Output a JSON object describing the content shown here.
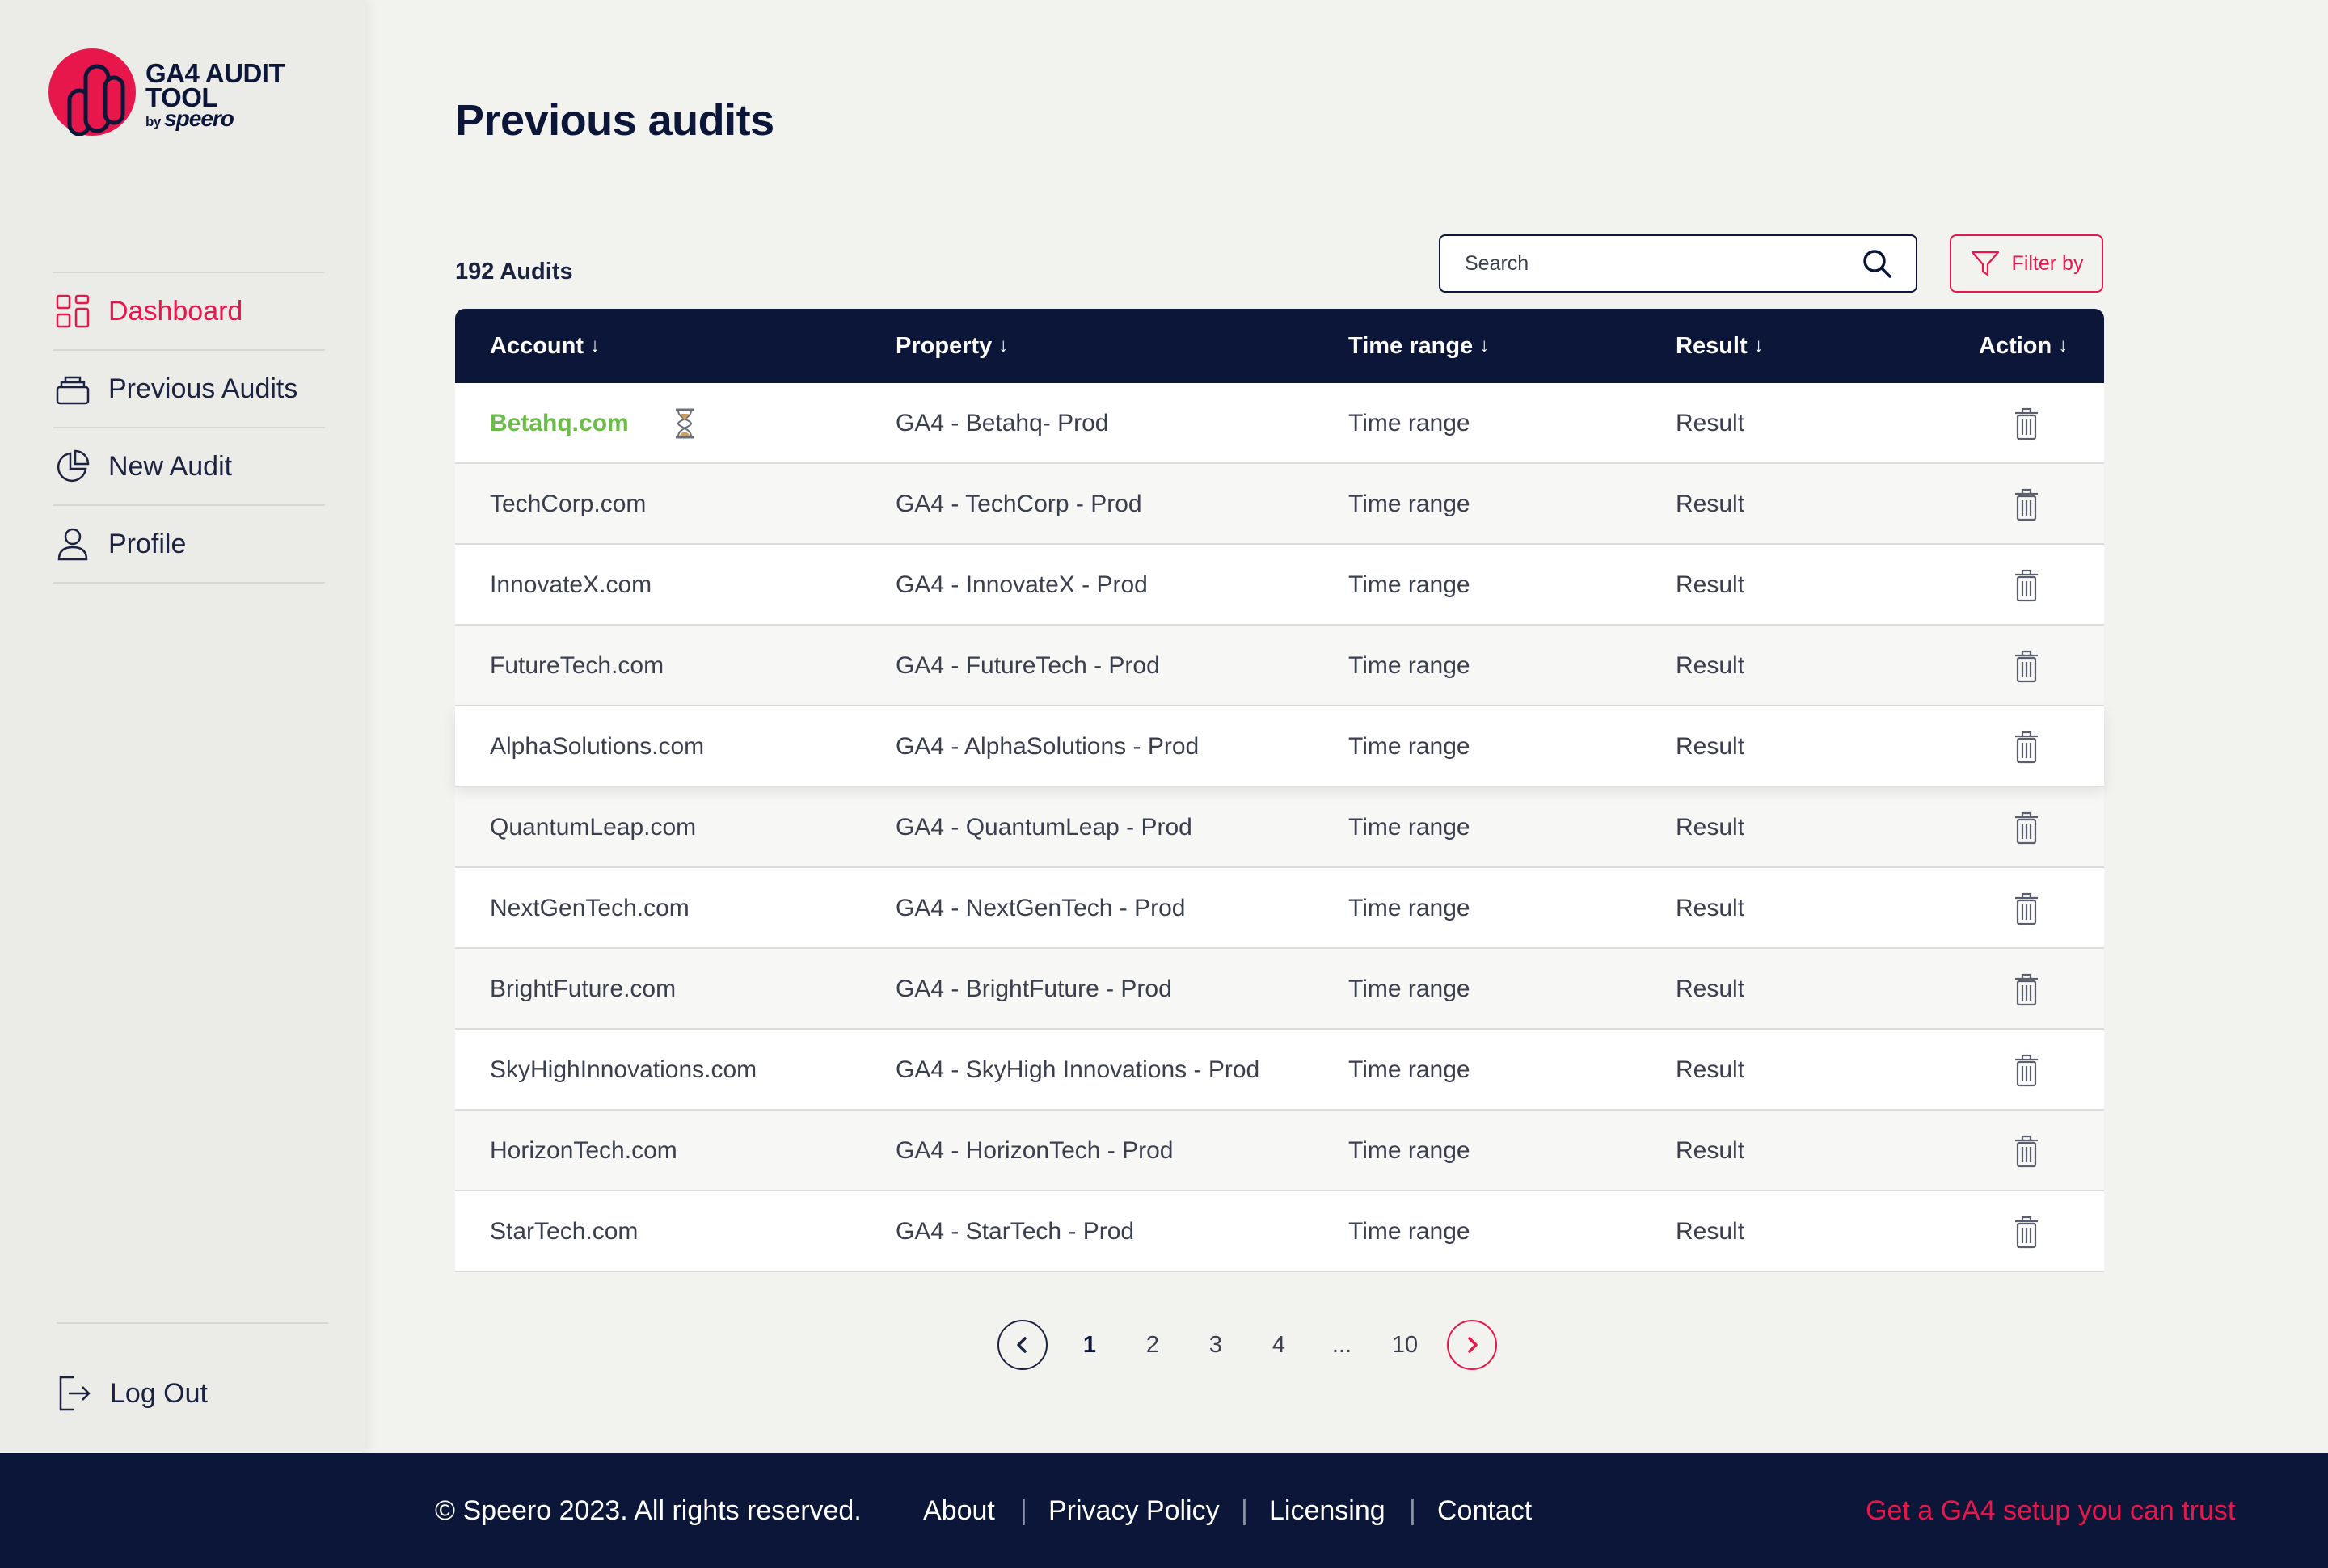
{
  "app": {
    "logo_line1": "GA4 AUDIT",
    "logo_line2": "TOOL",
    "logo_by": "by",
    "logo_brand": "speero"
  },
  "sidebar": {
    "items": [
      {
        "label": "Dashboard",
        "icon": "dashboard-grid-icon",
        "active": true
      },
      {
        "label": "Previous Audits",
        "icon": "stacked-layers-icon",
        "active": false
      },
      {
        "label": "New Audit",
        "icon": "pie-chart-icon",
        "active": false
      },
      {
        "label": "Profile",
        "icon": "user-icon",
        "active": false
      }
    ],
    "logout_label": "Log Out"
  },
  "main": {
    "title": "Previous audits",
    "count": "192 Audits",
    "search_placeholder": "Search",
    "filter_label": "Filter by"
  },
  "table": {
    "columns": [
      {
        "label": "Account"
      },
      {
        "label": "Property"
      },
      {
        "label": "Time range"
      },
      {
        "label": "Result"
      },
      {
        "label": "Action"
      }
    ],
    "sort_arrow": "↓",
    "rows": [
      {
        "account": "Betahq.com",
        "property": "GA4 - Betahq- Prod",
        "time_range": "Time range",
        "result": "Result",
        "status": "in-progress"
      },
      {
        "account": "TechCorp.com",
        "property": "GA4 - TechCorp - Prod",
        "time_range": "Time range",
        "result": "Result"
      },
      {
        "account": "InnovateX.com",
        "property": "GA4 - InnovateX - Prod",
        "time_range": "Time range",
        "result": "Result"
      },
      {
        "account": "FutureTech.com",
        "property": "GA4 - FutureTech - Prod",
        "time_range": "Time range",
        "result": "Result"
      },
      {
        "account": "AlphaSolutions.com",
        "property": "GA4 - AlphaSolutions - Prod",
        "time_range": "Time range",
        "result": "Result",
        "highlighted": true
      },
      {
        "account": "QuantumLeap.com",
        "property": "GA4 - QuantumLeap - Prod",
        "time_range": "Time range",
        "result": "Result"
      },
      {
        "account": "NextGenTech.com",
        "property": "GA4 - NextGenTech - Prod",
        "time_range": "Time range",
        "result": "Result"
      },
      {
        "account": "BrightFuture.com",
        "property": "GA4 - BrightFuture - Prod",
        "time_range": "Time range",
        "result": "Result"
      },
      {
        "account": "SkyHighInnovations.com",
        "property": "GA4 - SkyHigh Innovations - Prod",
        "time_range": "Time range",
        "result": "Result"
      },
      {
        "account": "HorizonTech.com",
        "property": "GA4 - HorizonTech - Prod",
        "time_range": "Time range",
        "result": "Result"
      },
      {
        "account": "StarTech.com",
        "property": "GA4 - StarTech - Prod",
        "time_range": "Time range",
        "result": "Result"
      }
    ]
  },
  "pagination": {
    "pages": [
      "1",
      "2",
      "3",
      "4",
      "...",
      "10"
    ],
    "current": "1"
  },
  "footer": {
    "copyright": "© Speero 2023. All rights reserved.",
    "links": [
      "About",
      "Privacy Policy",
      "Licensing",
      "Contact"
    ],
    "separator": "|",
    "tagline": "Get a GA4 setup you can trust"
  },
  "colors": {
    "navy": "#0c1638",
    "accent": "#e8174b",
    "success": "#6cbc49",
    "background": "#f2f2ef"
  }
}
